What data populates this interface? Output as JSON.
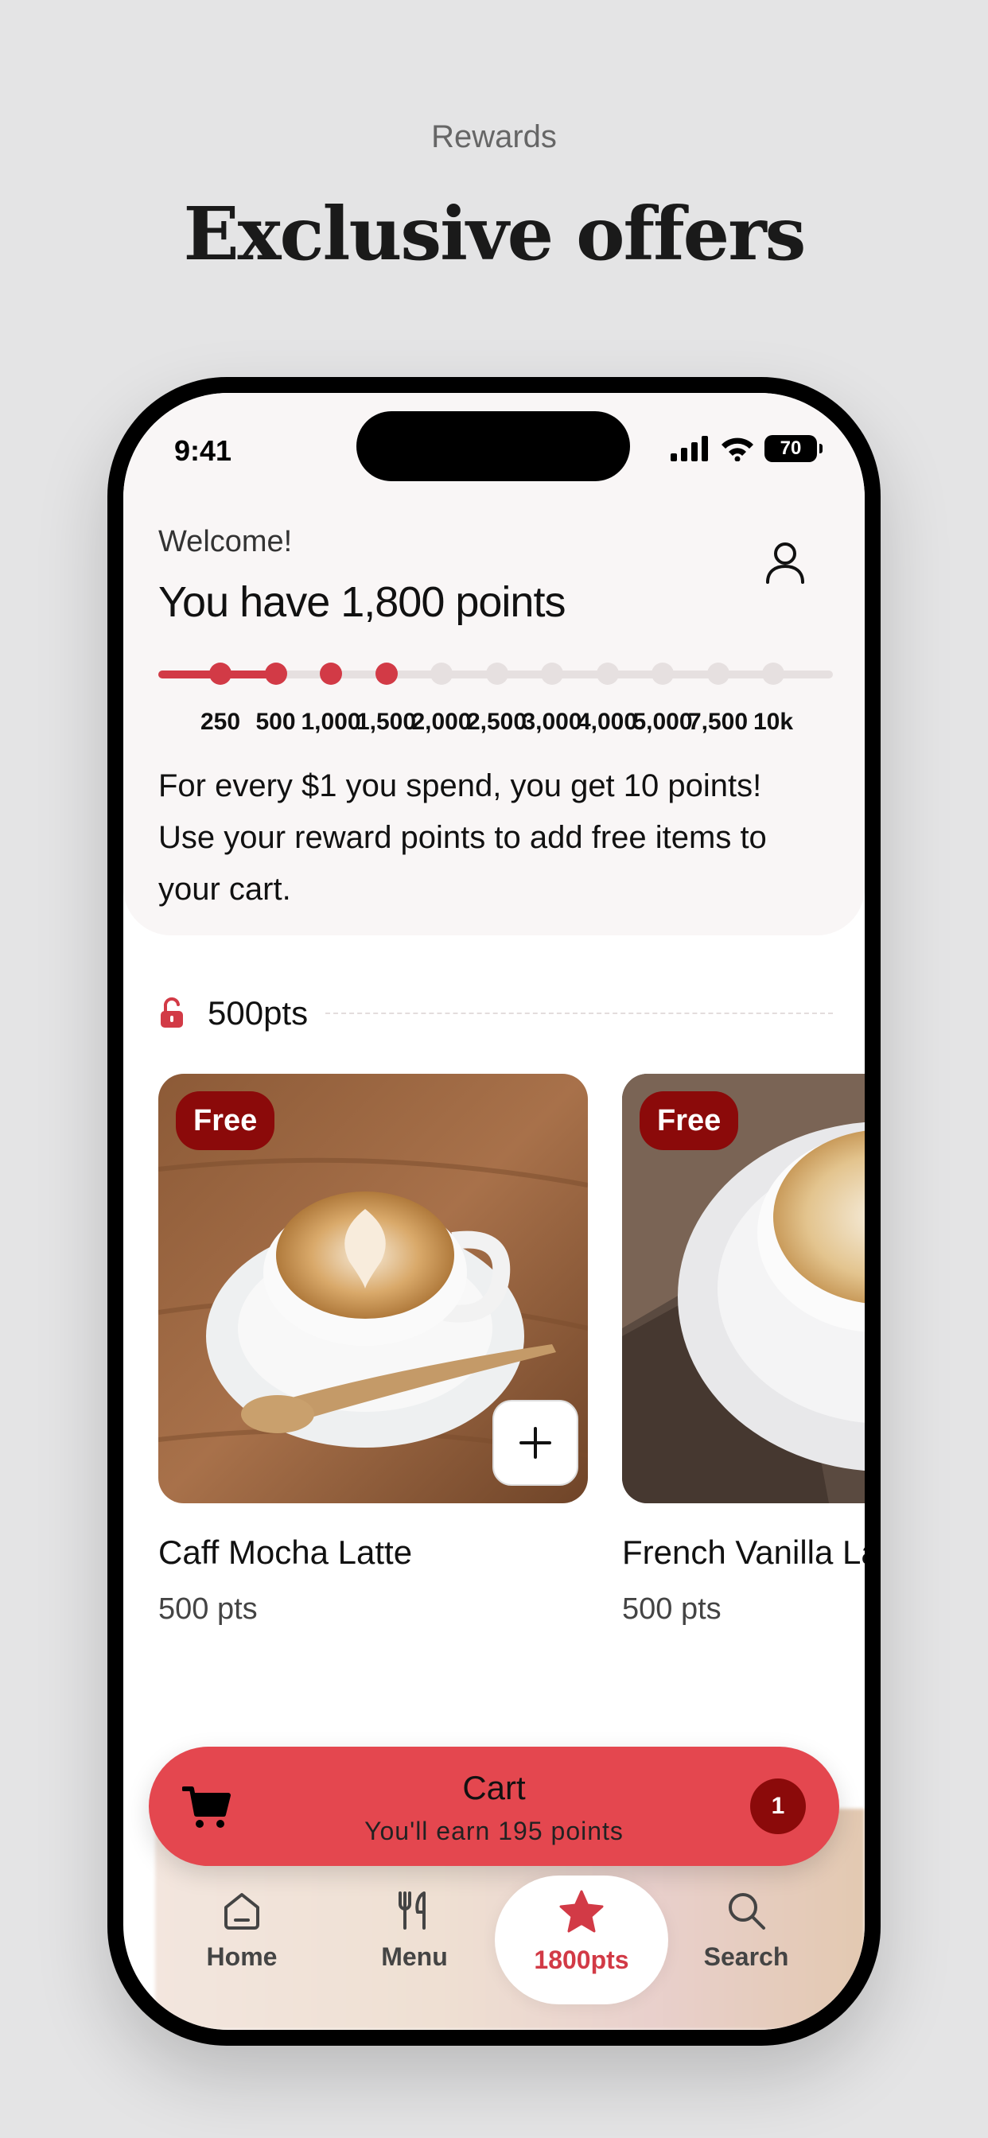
{
  "page": {
    "eyebrow": "Rewards",
    "headline": "Exclusive offers"
  },
  "status_bar": {
    "time": "9:41",
    "battery": "70"
  },
  "header": {
    "welcome": "Welcome!",
    "points_title": "You have 1,800 points",
    "progress": {
      "current_points": 1800,
      "milestones": [
        "250",
        "500",
        "1,000",
        "1,500",
        "2,000",
        "2,500",
        "3,000",
        "4,000",
        "5,000",
        "7,500",
        "10k"
      ],
      "reached_count": 4
    },
    "info_text": "For every $1 you spend, you get 10 points! Use your reward points to add free items to your cart."
  },
  "section": {
    "label": "500pts"
  },
  "items": [
    {
      "badge": "Free",
      "name": "Caff Mocha Latte",
      "points": "500 pts"
    },
    {
      "badge": "Free",
      "name": "French Vanilla Latte",
      "points": "500 pts"
    }
  ],
  "cart": {
    "title": "Cart",
    "subtitle": "You'll earn 195 points",
    "count": "1"
  },
  "nav": {
    "home": "Home",
    "menu": "Menu",
    "points": "1800pts",
    "search": "Search"
  },
  "colors": {
    "accent": "#d23a46",
    "badge": "#8b0a0a",
    "cart": "#e4474f"
  }
}
